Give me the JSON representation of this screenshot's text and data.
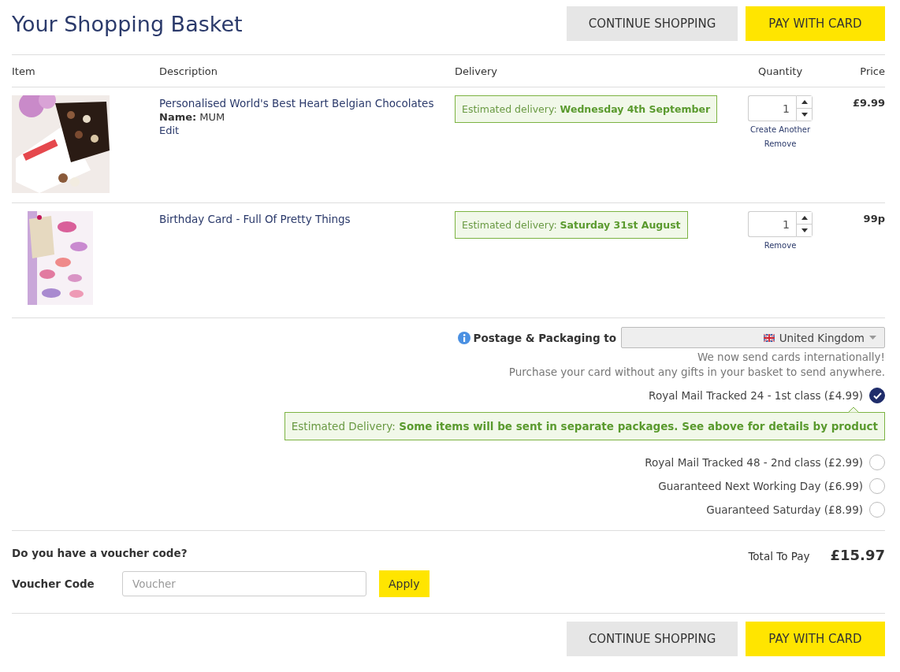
{
  "header": {
    "title": "Your Shopping Basket",
    "buttons": [
      {
        "label": "CONTINUE SHOPPING",
        "kind": "secondary"
      },
      {
        "label": "PAY WITH CARD",
        "kind": "primary"
      }
    ]
  },
  "table": {
    "columns": [
      "Item",
      "Description",
      "Delivery",
      "Quantity",
      "Price"
    ],
    "rows": [
      {
        "image": {
          "kind": "picture"
        },
        "title": "Personalised World's Best Heart Belgian Chocolates",
        "details": [
          "**Name:** MUM"
        ],
        "edit": "Edit",
        "delivery": "Estimated delivery: **Wednesday 4th September**",
        "quantity": "1",
        "links": [
          "Create Another",
          "Remove"
        ],
        "price": "£9.99"
      },
      {
        "image": {
          "kind": "picture"
        },
        "title": "Birthday Card - Full Of Pretty Things",
        "delivery": "Estimated delivery: **Saturday 31st August**",
        "quantity": "1",
        "links": [
          "Remove"
        ],
        "price": "99p"
      }
    ]
  },
  "postage": {
    "label": "Postage & Packaging to",
    "country": "United Kingdom",
    "notes": [
      "We now send cards internationally!",
      "Purchase your card without any gifts in your basket to send anywhere."
    ],
    "options": [
      {
        "label": "Royal Mail Tracked 24 - 1st class (£4.99)",
        "selected": true
      },
      {
        "label": "Royal Mail Tracked 48 - 2nd class (£2.99)",
        "selected": false
      },
      {
        "label": "Guaranteed Next Working Day (£6.99)",
        "selected": false
      },
      {
        "label": "Guaranteed Saturday (£8.99)",
        "selected": false
      }
    ],
    "estimate": "Estimated Delivery: **Some items will be sent in separate packages. See above for details by product**"
  },
  "voucher": {
    "question": "Do you have a voucher code?",
    "label": "Voucher Code",
    "placeholder": "Voucher",
    "button": "Apply"
  },
  "total": {
    "label": "Total To Pay",
    "value": "£15.97"
  },
  "footer": {
    "buttons": [
      {
        "label": "CONTINUE SHOPPING",
        "kind": "secondary"
      },
      {
        "label": "PAY WITH CARD",
        "kind": "primary"
      }
    ]
  }
}
